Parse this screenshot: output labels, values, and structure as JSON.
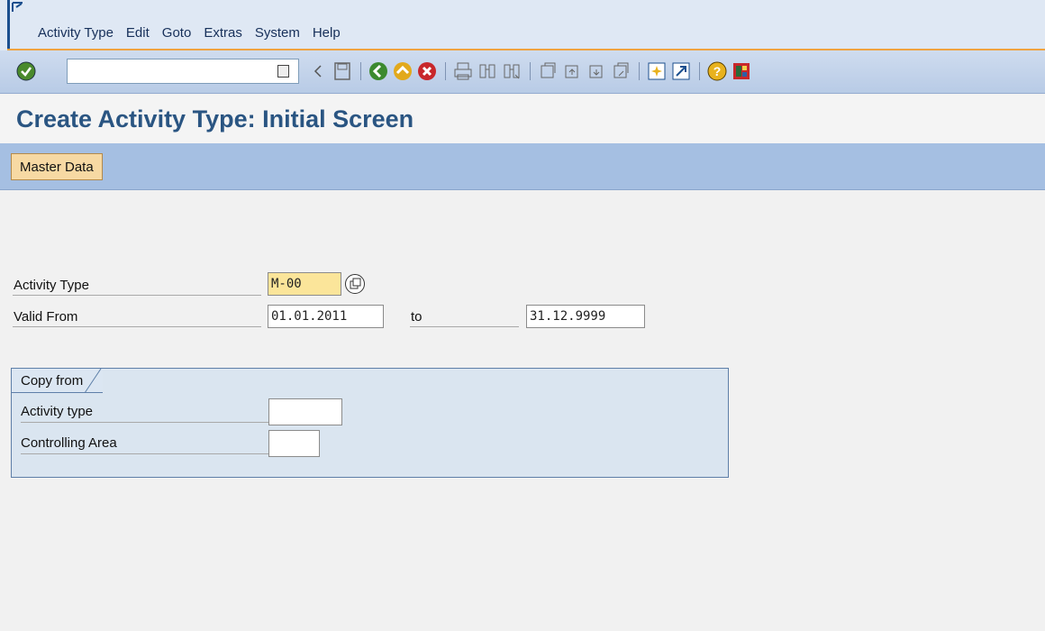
{
  "menubar": {
    "items": [
      {
        "label": "Activity Type"
      },
      {
        "label": "Edit"
      },
      {
        "label": "Goto"
      },
      {
        "label": "Extras"
      },
      {
        "label": "System"
      },
      {
        "label": "Help"
      }
    ]
  },
  "toolbar": {
    "command_field": "",
    "icons": [
      "enter-check-icon",
      "back-arrow-icon",
      "save-icon",
      "back-green-icon",
      "exit-yellow-icon",
      "cancel-red-icon",
      "print-icon",
      "find-icon",
      "find-next-icon",
      "first-page-icon",
      "previous-page-icon",
      "next-page-icon",
      "last-page-icon",
      "new-session-icon",
      "shortcut-icon",
      "help-icon",
      "layout-menu-icon"
    ]
  },
  "page": {
    "title": "Create Activity Type: Initial Screen"
  },
  "app_toolbar": {
    "master_data_label": "Master Data"
  },
  "form": {
    "activity_type_label": "Activity Type",
    "activity_type_value": "M-00",
    "valid_from_label": "Valid From",
    "valid_from_value": "01.01.2011",
    "to_label": "to",
    "valid_to_value": "31.12.9999"
  },
  "copy_from": {
    "title": "Copy from",
    "activity_type_label": "Activity type",
    "activity_type_value": "",
    "controlling_area_label": "Controlling Area",
    "controlling_area_value": ""
  },
  "colors": {
    "menubar_bg": "#dfe8f4",
    "accent_orange": "#f0a340",
    "title_blue": "#2a5582",
    "app_toolbar_bg": "#a5bfe2",
    "required_field": "#fbe59a",
    "button_bg": "#f7d9a3"
  }
}
